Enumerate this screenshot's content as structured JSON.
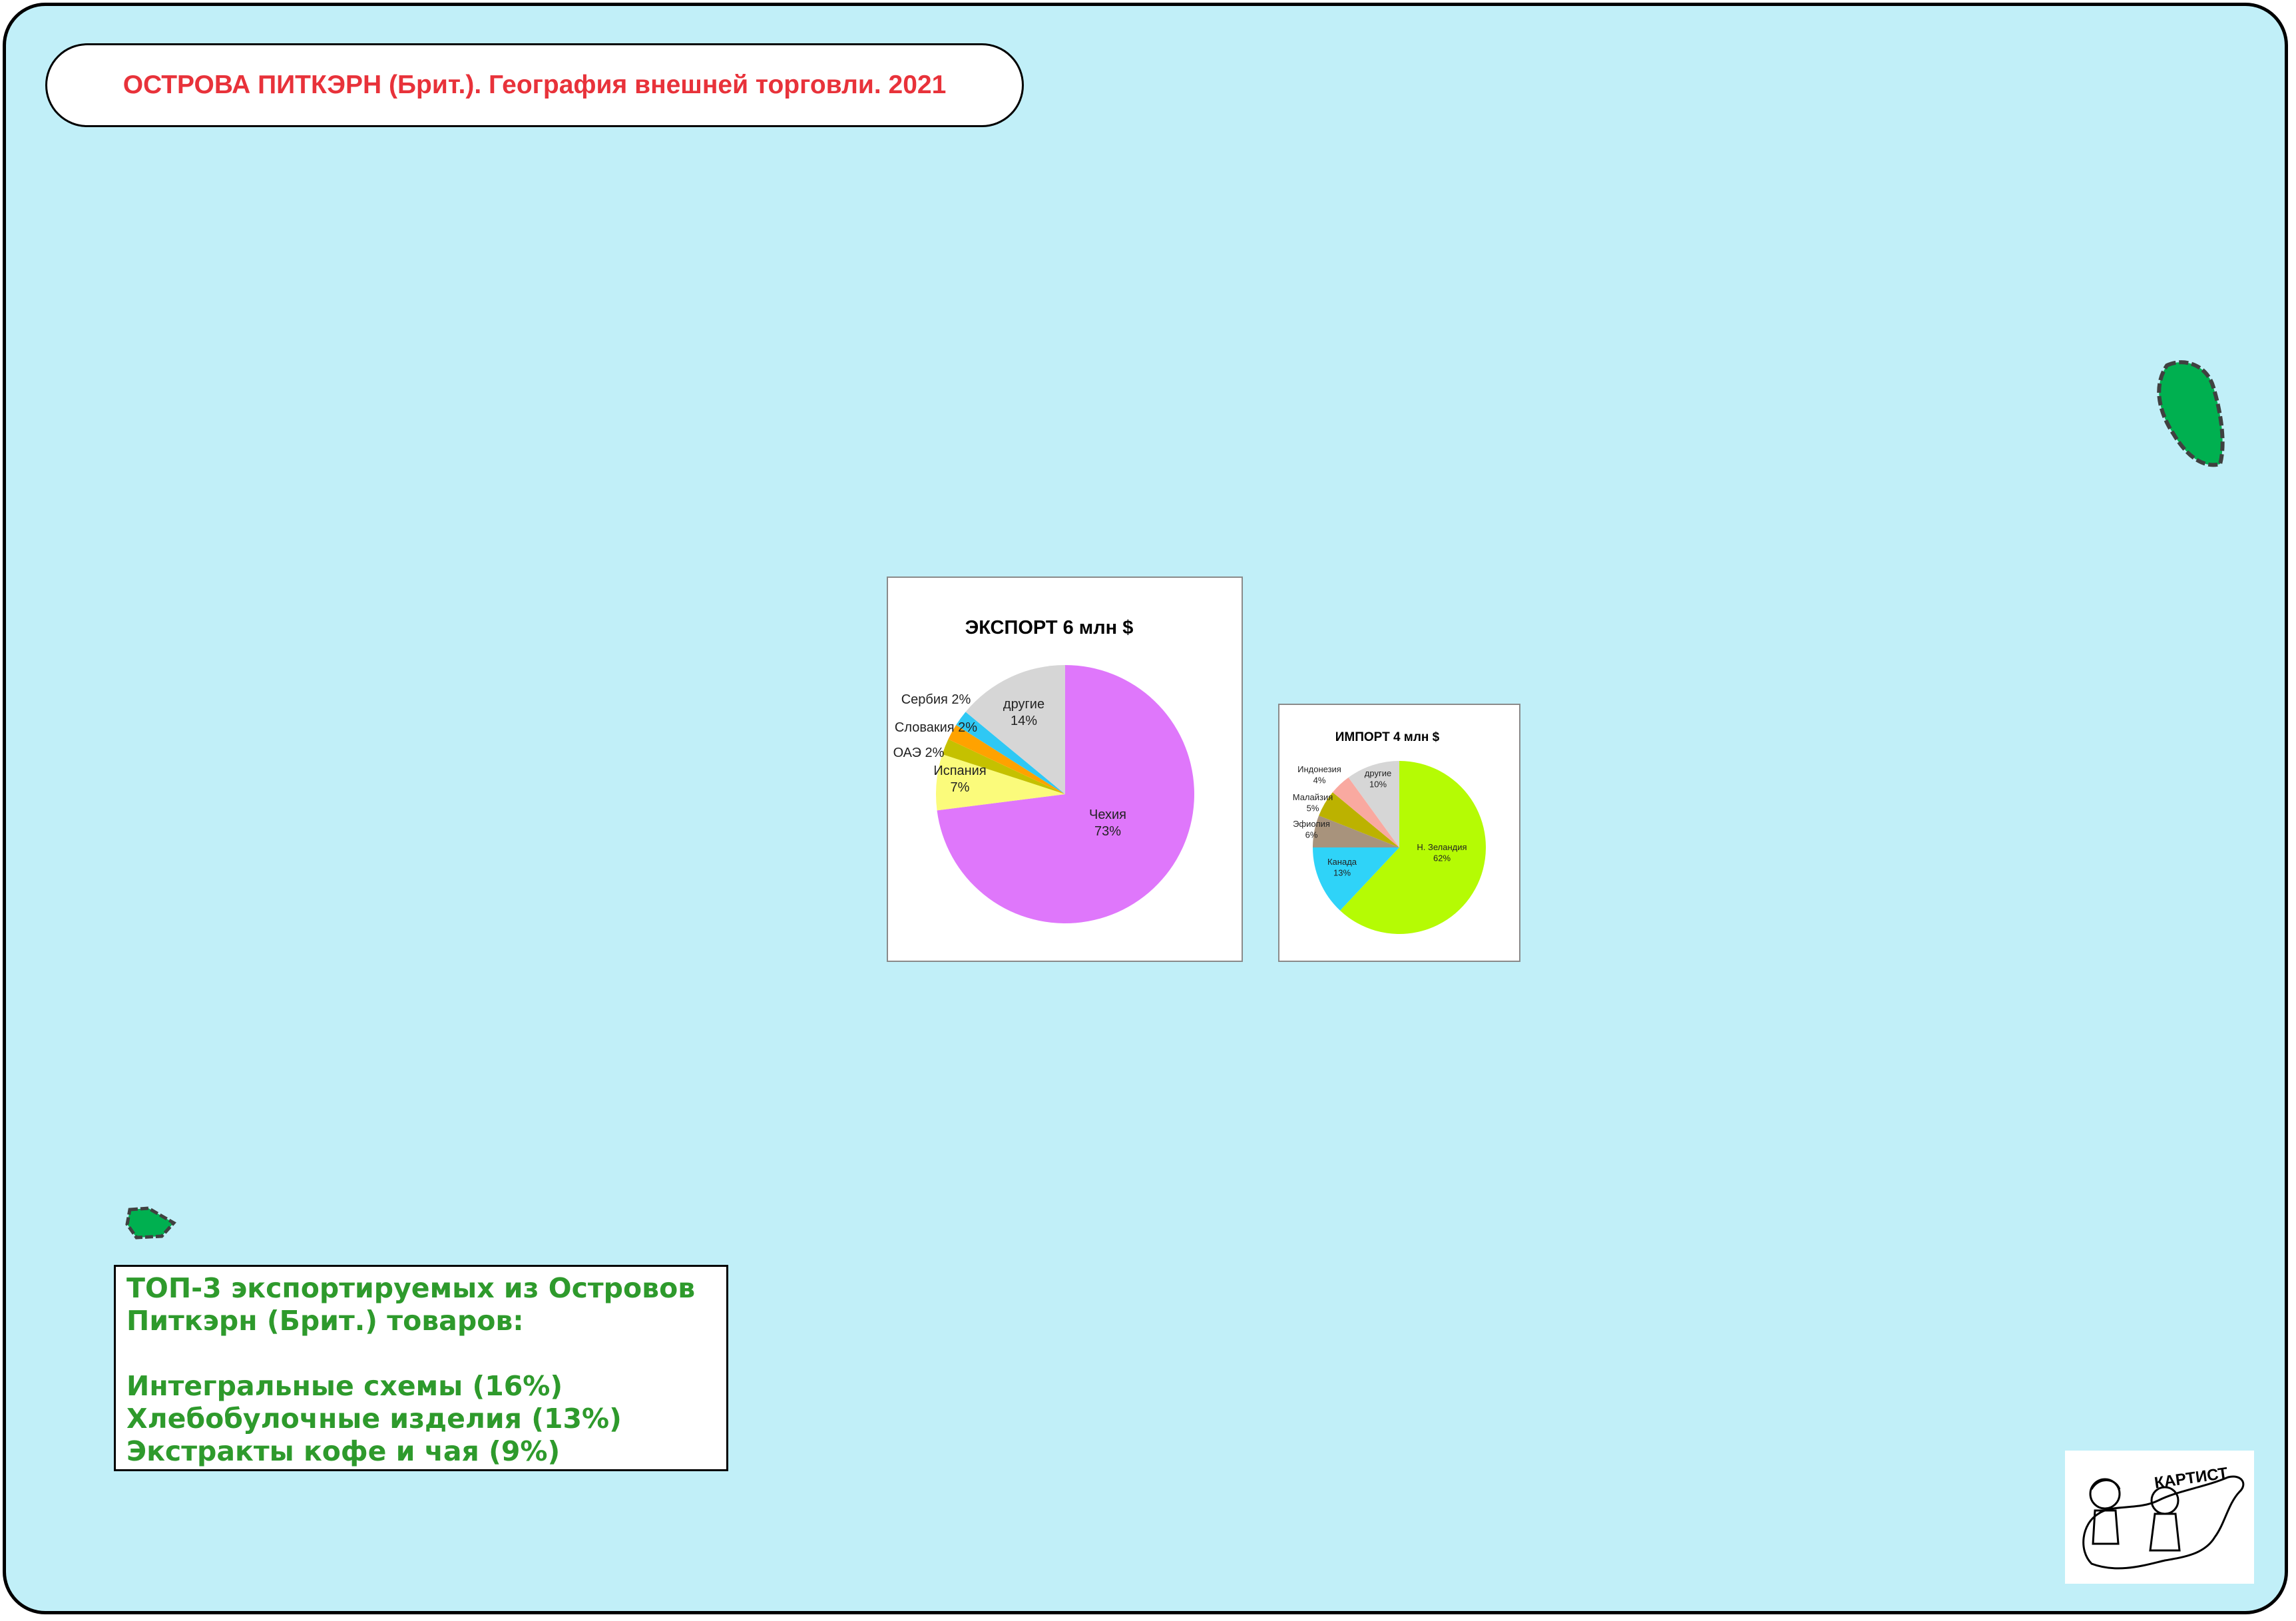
{
  "title": "ОСТРОВА ПИТКЭРН (Брит.). География внешней торговли. 2021",
  "colors": {
    "sea": "#c1eff8",
    "title": "#e8323a",
    "top3_text": "#2e9a2c",
    "island": "#00b050"
  },
  "export_chart": {
    "title": "ЭКСПОРТ 6 млн $"
  },
  "import_chart": {
    "title": "ИМПОРТ 4 млн $"
  },
  "chart_data": [
    {
      "type": "pie",
      "title": "ЭКСПОРТ 6 млн $",
      "categories": [
        "Чехия",
        "Испания",
        "ОАЭ",
        "Словакия",
        "Сербия",
        "другие"
      ],
      "values": [
        73,
        7,
        2,
        2,
        2,
        14
      ],
      "labels": [
        "Чехия\n73%",
        "Испания\n7%",
        "ОАЭ 2%",
        "Словакия 2%",
        "Сербия 2%",
        "другие\n14%"
      ],
      "colors": [
        "#df77fb",
        "#fbfb7b",
        "#c5c100",
        "#ffa200",
        "#2fc8f4",
        "#d6d6d6"
      ]
    },
    {
      "type": "pie",
      "title": "ИМПОРТ 4 млн $",
      "categories": [
        "Н. Зеландия",
        "Канада",
        "Эфиопия",
        "Малайзия",
        "Индонезия",
        "другие"
      ],
      "values": [
        62,
        13,
        6,
        5,
        4,
        10
      ],
      "labels": [
        "Н. Зеландия\n62%",
        "Канада\n13%",
        "Эфиопия\n6%",
        "Малайзия\n5%",
        "Индонезия\n4%",
        "другие\n10%"
      ],
      "colors": [
        "#b5fb04",
        "#2fd3f8",
        "#a8937c",
        "#bcb200",
        "#f9a9a0",
        "#d6d6d6"
      ]
    }
  ],
  "top3": {
    "heading_line1": "ТОП-3 экспортируемых из Островов",
    "heading_line2": "Питкэрн (Брит.) товаров:",
    "item1": "Интегральные схемы (16%)",
    "item2": "Хлебобулочные изделия (13%)",
    "item3": "Экстракты кофе и чая (9%)"
  },
  "logo": {
    "text": "КАРТИСТ"
  }
}
